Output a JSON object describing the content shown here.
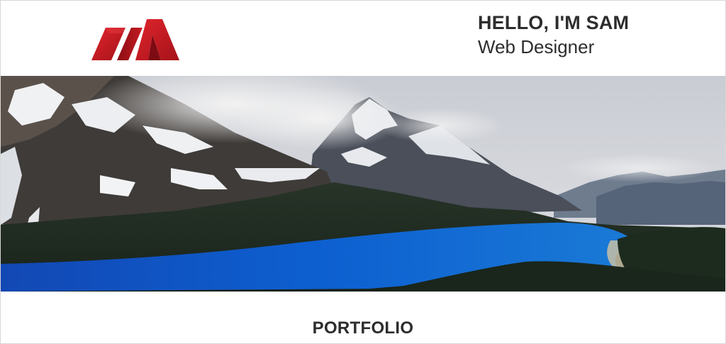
{
  "header": {
    "logo_name": "M logo",
    "brand_color": "#c8102e",
    "name_line": "HELLO, I'M SAM",
    "role_line": "Web Designer"
  },
  "hero": {
    "image_subject": "mountain lake landscape"
  },
  "portfolio": {
    "title": "PORTFOLIO"
  }
}
